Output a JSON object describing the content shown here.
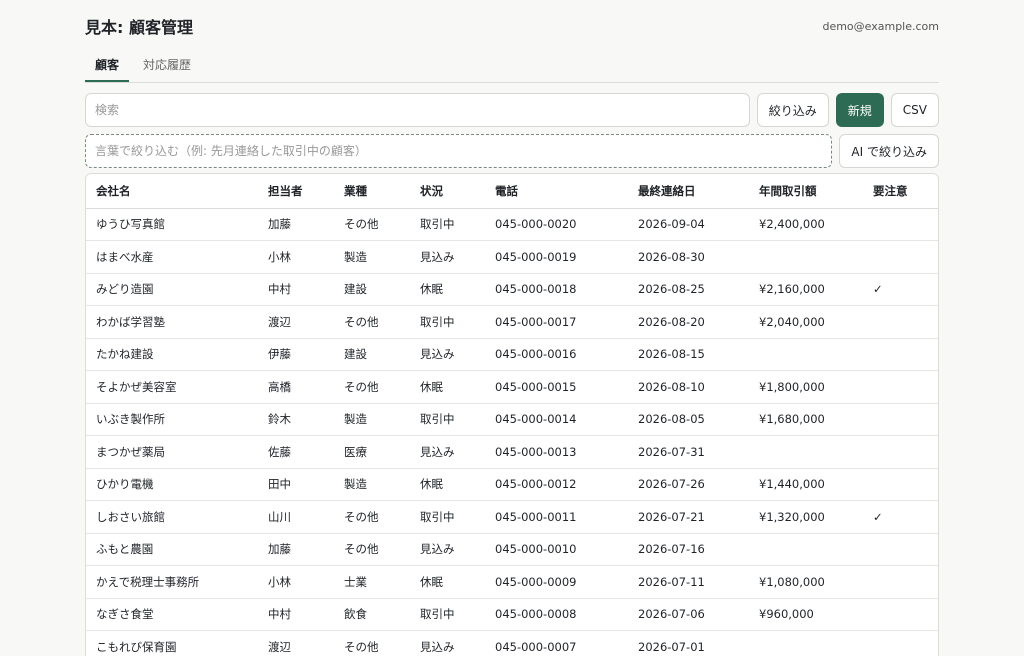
{
  "header": {
    "title": "見本: 顧客管理",
    "user_email": "demo@example.com"
  },
  "tabs": [
    {
      "label": "顧客",
      "active": true
    },
    {
      "label": "対応履歴",
      "active": false
    }
  ],
  "toolbar": {
    "search_placeholder": "検索",
    "filter_label": "絞り込み",
    "new_label": "新規",
    "csv_label": "CSV"
  },
  "ai_filter": {
    "placeholder": "言葉で絞り込む（例: 先月連絡した取引中の顧客）",
    "button_label": "AI で絞り込み"
  },
  "colors": {
    "accent": "#2e6b55"
  },
  "table": {
    "columns": [
      "会社名",
      "担当者",
      "業種",
      "状況",
      "電話",
      "最終連絡日",
      "年間取引額",
      "要注意"
    ],
    "rows": [
      [
        "ゆうひ写真館",
        "加藤",
        "その他",
        "取引中",
        "045-000-0020",
        "2026-09-04",
        "¥2,400,000",
        ""
      ],
      [
        "はまべ水産",
        "小林",
        "製造",
        "見込み",
        "045-000-0019",
        "2026-08-30",
        "",
        ""
      ],
      [
        "みどり造園",
        "中村",
        "建設",
        "休眠",
        "045-000-0018",
        "2026-08-25",
        "¥2,160,000",
        "✓"
      ],
      [
        "わかば学習塾",
        "渡辺",
        "その他",
        "取引中",
        "045-000-0017",
        "2026-08-20",
        "¥2,040,000",
        ""
      ],
      [
        "たかね建設",
        "伊藤",
        "建設",
        "見込み",
        "045-000-0016",
        "2026-08-15",
        "",
        ""
      ],
      [
        "そよかぜ美容室",
        "高橋",
        "その他",
        "休眠",
        "045-000-0015",
        "2026-08-10",
        "¥1,800,000",
        ""
      ],
      [
        "いぶき製作所",
        "鈴木",
        "製造",
        "取引中",
        "045-000-0014",
        "2026-08-05",
        "¥1,680,000",
        ""
      ],
      [
        "まつかぜ薬局",
        "佐藤",
        "医療",
        "見込み",
        "045-000-0013",
        "2026-07-31",
        "",
        ""
      ],
      [
        "ひかり電機",
        "田中",
        "製造",
        "休眠",
        "045-000-0012",
        "2026-07-26",
        "¥1,440,000",
        ""
      ],
      [
        "しおさい旅館",
        "山川",
        "その他",
        "取引中",
        "045-000-0011",
        "2026-07-21",
        "¥1,320,000",
        "✓"
      ],
      [
        "ふもと農園",
        "加藤",
        "その他",
        "見込み",
        "045-000-0010",
        "2026-07-16",
        "",
        ""
      ],
      [
        "かえで税理士事務所",
        "小林",
        "士業",
        "休眠",
        "045-000-0009",
        "2026-07-11",
        "¥1,080,000",
        ""
      ],
      [
        "なぎさ食堂",
        "中村",
        "飲食",
        "取引中",
        "045-000-0008",
        "2026-07-06",
        "¥960,000",
        ""
      ],
      [
        "こもれび保育園",
        "渡辺",
        "その他",
        "見込み",
        "045-000-0007",
        "2026-07-01",
        "",
        ""
      ]
    ]
  }
}
